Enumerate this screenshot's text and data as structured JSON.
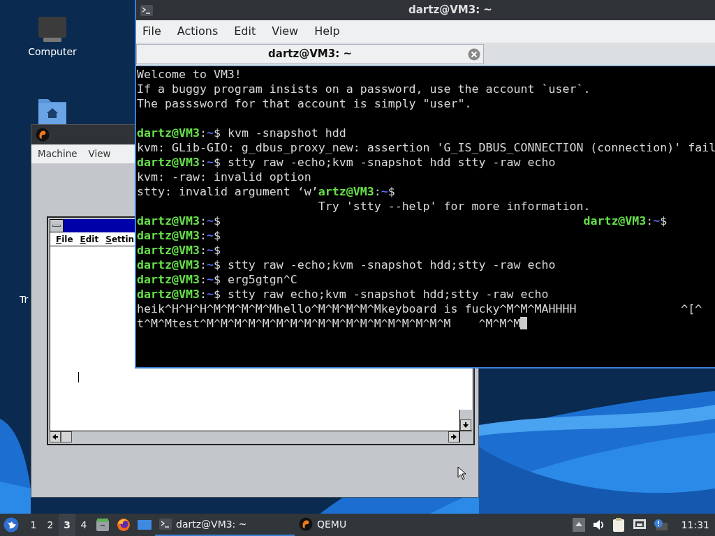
{
  "desktop": {
    "icons": [
      {
        "kind": "computer",
        "label": "Computer"
      },
      {
        "kind": "home"
      }
    ],
    "cut_label": "Tr"
  },
  "qemu_window": {
    "menu": [
      "Machine",
      "View"
    ],
    "guest_window": {
      "menu": [
        "File",
        "Edit",
        "Settin"
      ]
    }
  },
  "terminal": {
    "title": "dartz@VM3: ~",
    "menu": [
      "File",
      "Actions",
      "Edit",
      "View",
      "Help"
    ],
    "tabs": [
      {
        "label": "dartz@VM3: ~",
        "selected": true
      }
    ],
    "lines": [
      {
        "segments": [
          {
            "text": "Welcome to VM3!",
            "kind": "plain"
          }
        ]
      },
      {
        "segments": [
          {
            "text": "If a buggy program insists on a password, use the account `user`.",
            "kind": "plain"
          }
        ]
      },
      {
        "segments": [
          {
            "text": "The passsword for that account is simply \"user\".",
            "kind": "plain"
          }
        ]
      },
      {
        "kind": "blank"
      },
      {
        "segments": [
          {
            "text": "dartz@VM3",
            "kind": "user"
          },
          {
            "text": ":",
            "kind": "plain"
          },
          {
            "text": "~",
            "kind": "path"
          },
          {
            "text": "$ kvm -snapshot hdd",
            "kind": "plain"
          }
        ]
      },
      {
        "segments": [
          {
            "text": "kvm: GLib-GIO: g_dbus_proxy_new: assertion 'G_IS_DBUS_CONNECTION (connection)' fail",
            "kind": "plain"
          }
        ]
      },
      {
        "segments": [
          {
            "text": "dartz@VM3",
            "kind": "user"
          },
          {
            "text": ":",
            "kind": "plain"
          },
          {
            "text": "~",
            "kind": "path"
          },
          {
            "text": "$ stty raw -echo;kvm -snapshot hdd stty -raw echo",
            "kind": "plain"
          }
        ]
      },
      {
        "segments": [
          {
            "text": "kvm: -raw: invalid option",
            "kind": "plain"
          }
        ]
      },
      {
        "segments": [
          {
            "text": "stty: invalid argument ‘w’",
            "kind": "plain"
          },
          {
            "text": "artz@VM3",
            "kind": "user"
          },
          {
            "text": ":",
            "kind": "plain"
          },
          {
            "text": "~",
            "kind": "path"
          },
          {
            "text": "$",
            "kind": "plain"
          }
        ]
      },
      {
        "segments": [
          {
            "text": "                          Try 'stty --help' for more information.",
            "kind": "plain"
          }
        ]
      },
      {
        "segments": [
          {
            "text": "dartz@VM3",
            "kind": "user"
          },
          {
            "text": ":",
            "kind": "plain"
          },
          {
            "text": "~",
            "kind": "path"
          },
          {
            "text": "$                                                    ",
            "kind": "plain"
          },
          {
            "text": "dartz@VM3",
            "kind": "user"
          },
          {
            "text": ":",
            "kind": "plain"
          },
          {
            "text": "~",
            "kind": "path"
          },
          {
            "text": "$",
            "kind": "plain"
          }
        ]
      },
      {
        "segments": [
          {
            "text": "dartz@VM3",
            "kind": "user"
          },
          {
            "text": ":",
            "kind": "plain"
          },
          {
            "text": "~",
            "kind": "path"
          },
          {
            "text": "$",
            "kind": "plain"
          }
        ]
      },
      {
        "segments": [
          {
            "text": "dartz@VM3",
            "kind": "user"
          },
          {
            "text": ":",
            "kind": "plain"
          },
          {
            "text": "~",
            "kind": "path"
          },
          {
            "text": "$",
            "kind": "plain"
          }
        ]
      },
      {
        "segments": [
          {
            "text": "dartz@VM3",
            "kind": "user"
          },
          {
            "text": ":",
            "kind": "plain"
          },
          {
            "text": "~",
            "kind": "path"
          },
          {
            "text": "$ stty raw -echo;kvm -snapshot hdd;stty -raw echo",
            "kind": "plain"
          }
        ]
      },
      {
        "segments": [
          {
            "text": "dartz@VM3",
            "kind": "user"
          },
          {
            "text": ":",
            "kind": "plain"
          },
          {
            "text": "~",
            "kind": "path"
          },
          {
            "text": "$ erg5gtgn^C",
            "kind": "plain"
          }
        ]
      },
      {
        "segments": [
          {
            "text": "dartz@VM3",
            "kind": "user"
          },
          {
            "text": ":",
            "kind": "plain"
          },
          {
            "text": "~",
            "kind": "path"
          },
          {
            "text": "$ stty raw echo;kvm -snapshot hdd;stty -raw echo",
            "kind": "plain"
          }
        ]
      },
      {
        "segments": [
          {
            "text": "heik^H^H^H^M^M^M^M^Mhello^M^M^M^M^Mkeyboard is fucky^M^M^MAHHHH               ^[^",
            "kind": "plain"
          }
        ]
      },
      {
        "cursor": true,
        "segments": [
          {
            "text": "t^M^Mtest^M^M^M^M^M^M^M^M^M^M^M^M^M^M^M^M^M^M    ^M^M^M",
            "kind": "plain"
          }
        ]
      }
    ]
  },
  "taskbar": {
    "workspaces": [
      {
        "label": "1",
        "selected": false
      },
      {
        "label": "2",
        "selected": false
      },
      {
        "label": "3",
        "selected": true
      },
      {
        "label": "4",
        "selected": false
      }
    ],
    "launchers": [
      {
        "kind": "files"
      },
      {
        "kind": "browser"
      },
      {
        "kind": "desktop"
      }
    ],
    "tasks": [
      {
        "kind": "terminal",
        "label": "dartz@VM3: ~",
        "selected": true
      },
      {
        "kind": "qemu",
        "label": "QEMU",
        "selected": false
      }
    ],
    "tray": [
      {
        "kind": "up"
      },
      {
        "kind": "volume"
      },
      {
        "kind": "clipboard"
      },
      {
        "kind": "network"
      },
      {
        "kind": "notification"
      }
    ],
    "clock": "11:31"
  }
}
